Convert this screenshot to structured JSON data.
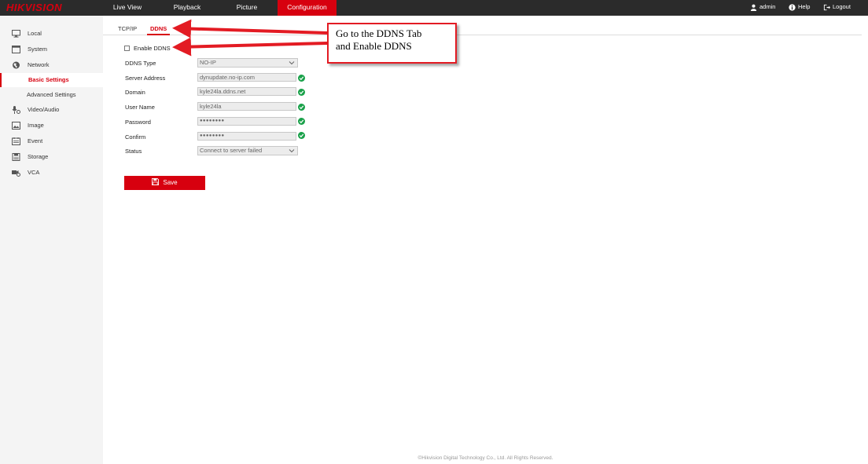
{
  "brand": "HIKVISION",
  "nav": {
    "items": [
      "Live View",
      "Playback",
      "Picture",
      "Configuration"
    ],
    "active": "Configuration"
  },
  "user": {
    "name": "admin",
    "help": "Help",
    "logout": "Logout"
  },
  "sidebar": {
    "items": [
      {
        "label": "Local",
        "icon": "monitor-icon"
      },
      {
        "label": "System",
        "icon": "system-icon"
      },
      {
        "label": "Network",
        "icon": "globe-icon"
      },
      {
        "label": "Basic Settings",
        "sub": true,
        "active": true
      },
      {
        "label": "Advanced Settings",
        "sub": true
      },
      {
        "label": "Video/Audio",
        "icon": "video-audio-icon"
      },
      {
        "label": "Image",
        "icon": "image-icon"
      },
      {
        "label": "Event",
        "icon": "event-icon"
      },
      {
        "label": "Storage",
        "icon": "storage-icon"
      },
      {
        "label": "VCA",
        "icon": "vca-icon"
      }
    ]
  },
  "tabs": {
    "tcpip": "TCP/IP",
    "ddns": "DDNS",
    "active": "DDNS"
  },
  "form": {
    "enable_ddns": {
      "label": "Enable DDNS",
      "checked": false
    },
    "ddns_type": {
      "label": "DDNS Type",
      "value": "NO-IP"
    },
    "server_address": {
      "label": "Server Address",
      "value": "dynupdate.no-ip.com"
    },
    "domain": {
      "label": "Domain",
      "value": "kyle24la.ddns.net"
    },
    "user_name": {
      "label": "User Name",
      "value": "kyle24la"
    },
    "password": {
      "label": "Password",
      "value": "●●●●●●●●"
    },
    "confirm": {
      "label": "Confirm",
      "value": "●●●●●●●●"
    },
    "status": {
      "label": "Status",
      "value": "Connect to server failed"
    }
  },
  "save_label": "Save",
  "callout": {
    "line1": "Go to the DDNS Tab",
    "line2": "and Enable DDNS"
  },
  "footer": "©Hikvision Digital Technology Co., Ltd. All Rights Reserved.",
  "colors": {
    "accent": "#d7000f",
    "topbar": "#2b2b2b",
    "ok": "#1aa14a",
    "arrow": "#e31b23"
  }
}
